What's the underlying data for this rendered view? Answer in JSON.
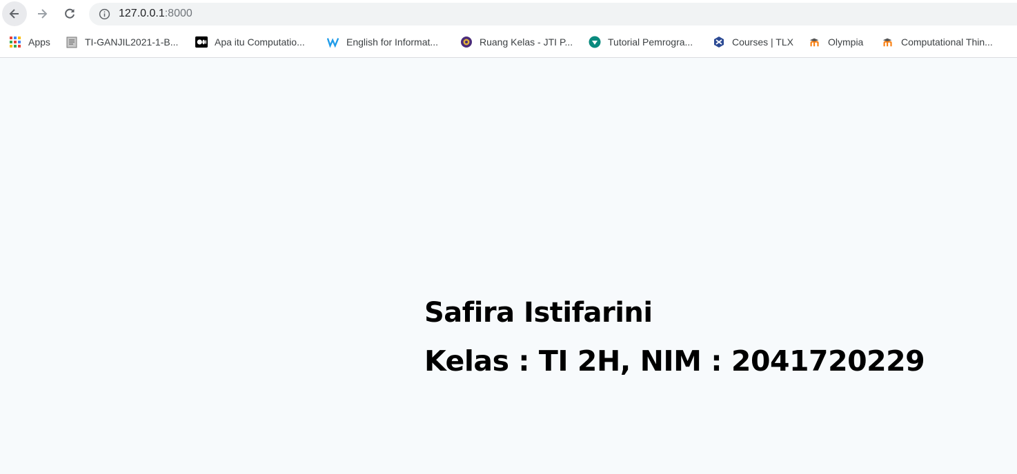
{
  "browser": {
    "url_host": "127.0.0.1",
    "url_port": ":8000",
    "icons": {
      "back": "arrow-left-icon",
      "forward": "arrow-right-icon",
      "reload": "reload-icon",
      "info": "info-icon"
    }
  },
  "bookmarks": [
    {
      "label": "Apps",
      "icon": "apps-grid-icon"
    },
    {
      "label": "TI-GANJIL2021-1-B...",
      "icon": "page-icon"
    },
    {
      "label": "Apa itu Computatio...",
      "icon": "medium-icon"
    },
    {
      "label": "English for Informat...",
      "icon": "w-logo-icon"
    },
    {
      "label": "Ruang Kelas - JTI P...",
      "icon": "emblem-icon"
    },
    {
      "label": "Tutorial Pemrogra...",
      "icon": "teal-circle-icon"
    },
    {
      "label": "Courses | TLX",
      "icon": "tlx-icon"
    },
    {
      "label": "Olympia",
      "icon": "moodle-icon"
    },
    {
      "label": "Computational Thin...",
      "icon": "moodle-icon"
    }
  ],
  "main": {
    "name": "Safira Istifarini",
    "info": "Kelas : TI 2H, NIM : 2041720229"
  },
  "colors": {
    "page_background": "#f7fafc",
    "toolbar": "#ffffff",
    "omnibox": "#f1f3f4",
    "text": "#000000"
  }
}
